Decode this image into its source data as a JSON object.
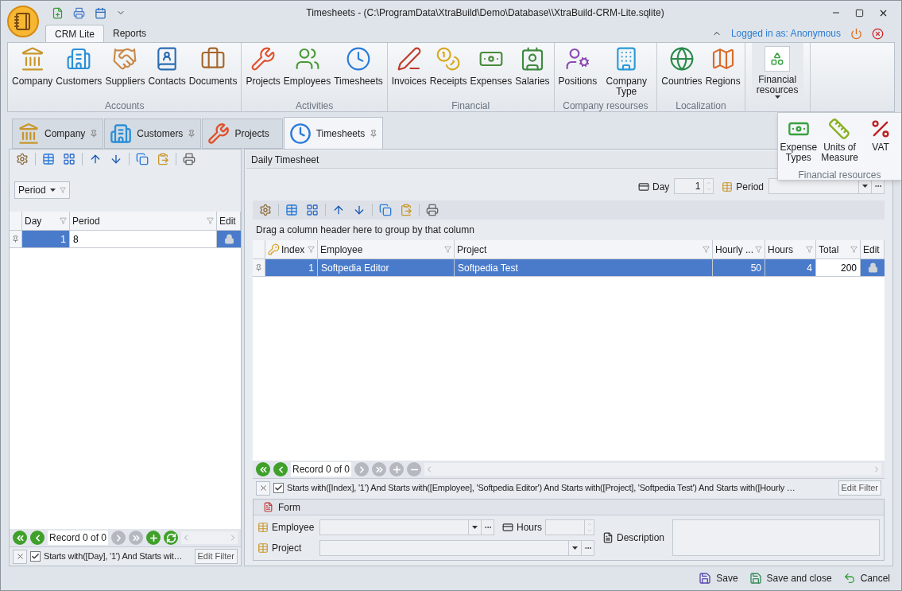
{
  "window": {
    "title": "Timesheets -  (C:\\ProgramData\\XtraBuild\\Demo\\Database\\\\XtraBuild-CRM-Lite.sqlite)"
  },
  "ribbon_tabs": [
    {
      "label": "CRM Lite",
      "selected": true
    },
    {
      "label": "Reports",
      "selected": false
    }
  ],
  "user": {
    "label": "Logged in as: Anonymous"
  },
  "ribbon_groups": [
    {
      "label": "Accounts",
      "buttons": [
        "Company",
        "Customers",
        "Suppliers",
        "Contacts",
        "Documents"
      ]
    },
    {
      "label": "Activities",
      "buttons": [
        "Projects",
        "Employees",
        "Timesheets"
      ]
    },
    {
      "label": "Financial",
      "buttons": [
        "Invoices",
        "Receipts",
        "Expenses",
        "Salaries"
      ]
    },
    {
      "label": "Company resourses",
      "buttons": [
        "Positions",
        "Company Type"
      ]
    },
    {
      "label": "Localization",
      "buttons": [
        "Countries",
        "Regions"
      ]
    }
  ],
  "financial_menu": {
    "label": "Financial resources",
    "expanded": true,
    "group_label": "Financial resources",
    "items": [
      "Expense Types",
      "Units of Measure",
      "VAT"
    ]
  },
  "doc_tabs": [
    {
      "label": "Company",
      "selected": false,
      "pinned": true
    },
    {
      "label": "Customers",
      "selected": false,
      "pinned": true
    },
    {
      "label": "Projects",
      "selected": false,
      "pinned": false
    },
    {
      "label": "Timesheets",
      "selected": true,
      "pinned": true
    }
  ],
  "left_panel": {
    "group_button": "Period",
    "columns": [
      "Day",
      "Period",
      "Edit"
    ],
    "rows": [
      {
        "selected": true,
        "cells": [
          {
            "text": "1",
            "focused": false
          },
          {
            "text": "8",
            "focused": true
          }
        ]
      }
    ],
    "navigator": {
      "text": "Record 0 of 0",
      "buttons": [
        {
          "kind": "first",
          "disabled": false
        },
        {
          "kind": "prev",
          "disabled": false
        },
        {
          "kind": "next",
          "disabled": true
        },
        {
          "kind": "last",
          "disabled": true
        },
        {
          "kind": "add",
          "disabled": false
        },
        {
          "kind": "refresh",
          "disabled": false
        }
      ]
    },
    "filter": {
      "checked": true,
      "text": "Starts with([Day], '1') And Starts wit…",
      "button": "Edit Filter"
    }
  },
  "right_panel": {
    "title": "Daily Timesheet",
    "day": {
      "label": "Day",
      "value": "1"
    },
    "period": {
      "label": "Period"
    },
    "group_hint": "Drag a column header here to group by that column",
    "columns": [
      "Index",
      "Employee",
      "Project",
      "Hourly ...",
      "Hours",
      "Total",
      "Edit"
    ],
    "rows": [
      {
        "selected": true,
        "cells": [
          {
            "text": "1",
            "focused": false
          },
          {
            "text": "Softpedia Editor",
            "focused": false
          },
          {
            "text": "Softpedia Test",
            "focused": false
          },
          {
            "text": "50",
            "focused": false
          },
          {
            "text": "4",
            "focused": false
          },
          {
            "text": "200",
            "focused": true
          }
        ]
      }
    ],
    "navigator": {
      "text": "Record 0 of 0",
      "buttons": [
        {
          "kind": "first",
          "disabled": false
        },
        {
          "kind": "prev",
          "disabled": false
        },
        {
          "kind": "next",
          "disabled": true
        },
        {
          "kind": "last",
          "disabled": true
        },
        {
          "kind": "add",
          "disabled": true
        },
        {
          "kind": "remove",
          "disabled": true
        }
      ]
    },
    "filter": {
      "checked": true,
      "text": "Starts with([Index], '1') And Starts with([Employee], 'Softpedia Editor') And Starts with([Project], 'Softpedia Test') And Starts with([Hourly …",
      "button": "Edit Filter"
    },
    "form": {
      "title": "Form",
      "employee": "Employee",
      "hours": "Hours",
      "project": "Project",
      "description": "Description"
    }
  },
  "bottom_buttons": [
    "Save",
    "Save and close",
    "Cancel"
  ]
}
